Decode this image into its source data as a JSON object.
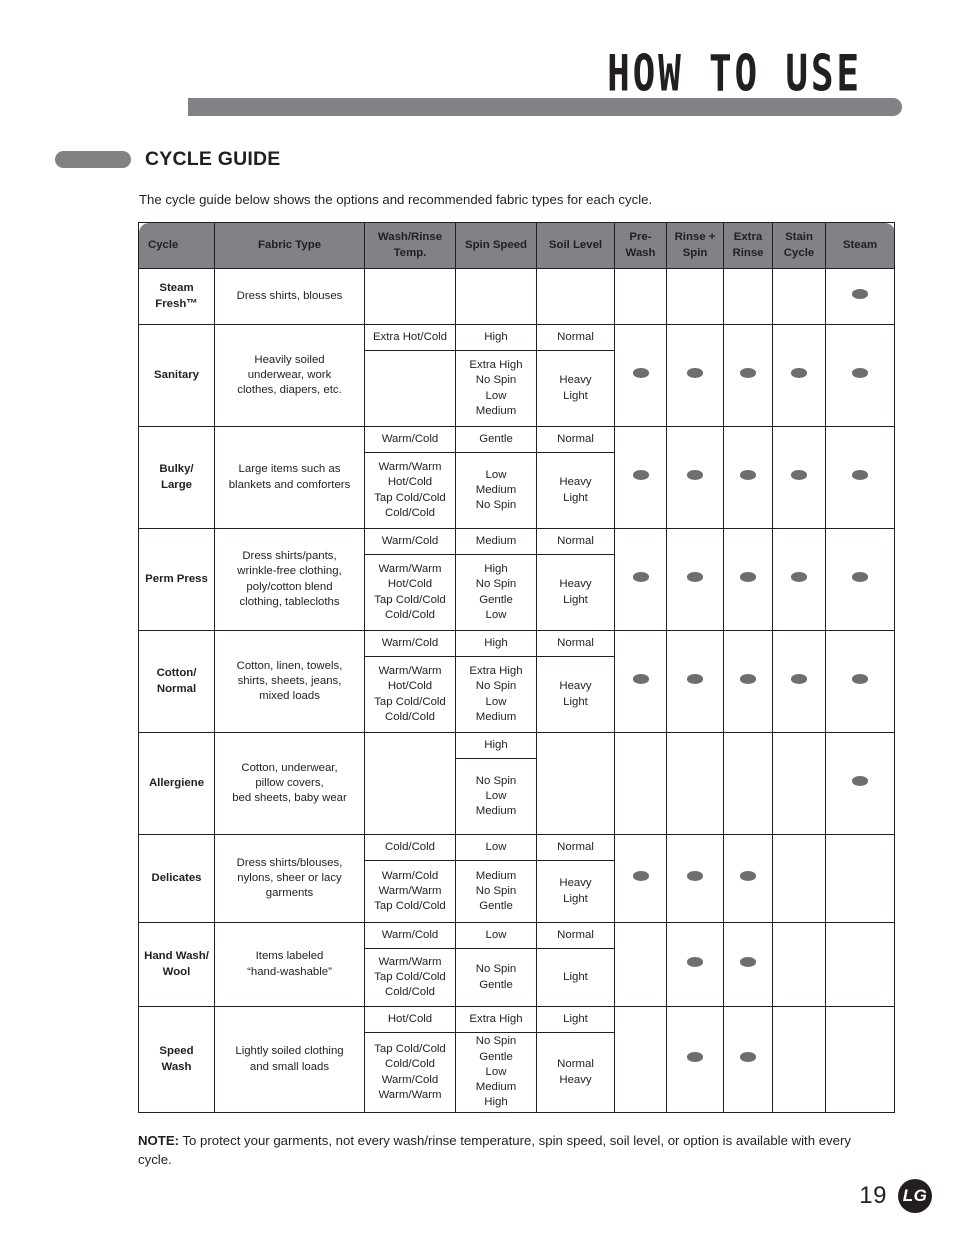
{
  "page": {
    "header_title": "HOW TO USE",
    "section_title": "CYCLE GUIDE",
    "intro": "The cycle guide below shows the options and recommended fabric types for each cycle.",
    "note_label": "NOTE:",
    "note_text": " To protect your garments, not every wash/rinse temperature, spin speed, soil level, or option is available with every cycle.",
    "page_number": "19",
    "brand": "LG",
    "accent_gray": "#808285",
    "dot_color": "#6d6e71",
    "text_color": "#231f20"
  },
  "table": {
    "headers": [
      "Cycle",
      "Fabric Type",
      "Wash/Rinse Temp.",
      "Spin Speed",
      "Soil Level",
      "Pre-Wash",
      "Rinse + Spin",
      "Extra Rinse",
      "Stain Cycle",
      "Steam"
    ],
    "headers_lines": [
      [
        "Cycle"
      ],
      [
        "Fabric Type"
      ],
      [
        "Wash/Rinse",
        "Temp."
      ],
      [
        "Spin Speed"
      ],
      [
        "Soil Level"
      ],
      [
        "Pre-",
        "Wash"
      ],
      [
        "Rinse +",
        "Spin"
      ],
      [
        "Extra",
        "Rinse"
      ],
      [
        "Stain",
        "Cycle"
      ],
      [
        "Steam"
      ]
    ],
    "rows": [
      {
        "cycle": "Steam Fresh™",
        "cycle_lines": [
          "Steam",
          "Fresh™"
        ],
        "fabric": "Dress shirts, blouses",
        "wash_rinse_top": "",
        "wash_rinse_bottom": [],
        "spin_top": "",
        "spin_bottom": [],
        "soil_top": "",
        "soil_bottom": [],
        "options": {
          "pre_wash": false,
          "rinse_spin": false,
          "extra_rinse": false,
          "stain_cycle": false,
          "steam": true
        }
      },
      {
        "cycle": "Sanitary",
        "cycle_lines": [
          "Sanitary"
        ],
        "fabric": "Heavily soiled underwear, work clothes, diapers, etc.",
        "fabric_lines": [
          "Heavily soiled",
          "underwear, work",
          "clothes, diapers, etc."
        ],
        "wash_rinse_top": "Extra Hot/Cold",
        "wash_rinse_bottom": [],
        "spin_top": "High",
        "spin_bottom": [
          "Extra High",
          "No Spin",
          "Low",
          "Medium"
        ],
        "soil_top": "Normal",
        "soil_bottom": [
          "Heavy",
          "Light"
        ],
        "options": {
          "pre_wash": true,
          "rinse_spin": true,
          "extra_rinse": true,
          "stain_cycle": true,
          "steam": true
        }
      },
      {
        "cycle": "Bulky/ Large",
        "cycle_lines": [
          "Bulky/",
          "Large"
        ],
        "fabric": "Large items such as blankets and comforters",
        "fabric_lines": [
          "Large items such as",
          "blankets and comforters"
        ],
        "wash_rinse_top": "Warm/Cold",
        "wash_rinse_bottom": [
          "Warm/Warm",
          "Hot/Cold",
          "Tap Cold/Cold",
          "Cold/Cold"
        ],
        "spin_top": "Gentle",
        "spin_bottom": [
          "Low",
          "Medium",
          "No Spin"
        ],
        "soil_top": "Normal",
        "soil_bottom": [
          "Heavy",
          "Light"
        ],
        "options": {
          "pre_wash": true,
          "rinse_spin": true,
          "extra_rinse": true,
          "stain_cycle": true,
          "steam": true
        }
      },
      {
        "cycle": "Perm Press",
        "cycle_lines": [
          "Perm Press"
        ],
        "fabric": "Dress shirts/pants, wrinkle-free clothing, poly/cotton blend clothing, tablecloths",
        "fabric_lines": [
          "Dress shirts/pants,",
          "wrinkle-free clothing,",
          "poly/cotton blend",
          "clothing, tablecloths"
        ],
        "wash_rinse_top": "Warm/Cold",
        "wash_rinse_bottom": [
          "Warm/Warm",
          "Hot/Cold",
          "Tap Cold/Cold",
          "Cold/Cold"
        ],
        "spin_top": "Medium",
        "spin_bottom": [
          "High",
          "No Spin",
          "Gentle",
          "Low"
        ],
        "soil_top": "Normal",
        "soil_bottom": [
          "Heavy",
          "Light"
        ],
        "options": {
          "pre_wash": true,
          "rinse_spin": true,
          "extra_rinse": true,
          "stain_cycle": true,
          "steam": true
        }
      },
      {
        "cycle": "Cotton/ Normal",
        "cycle_lines": [
          "Cotton/",
          "Normal"
        ],
        "fabric": "Cotton, linen, towels, shirts, sheets, jeans, mixed loads",
        "fabric_lines": [
          "Cotton, linen, towels,",
          "shirts, sheets, jeans,",
          "mixed loads"
        ],
        "wash_rinse_top": "Warm/Cold",
        "wash_rinse_bottom": [
          "Warm/Warm",
          "Hot/Cold",
          "Tap Cold/Cold",
          "Cold/Cold"
        ],
        "spin_top": "High",
        "spin_bottom": [
          "Extra High",
          "No Spin",
          "Low",
          "Medium"
        ],
        "soil_top": "Normal",
        "soil_bottom": [
          "Heavy",
          "Light"
        ],
        "options": {
          "pre_wash": true,
          "rinse_spin": true,
          "extra_rinse": true,
          "stain_cycle": true,
          "steam": true
        }
      },
      {
        "cycle": "Allergiene",
        "cycle_lines": [
          "Allergiene"
        ],
        "fabric": "Cotton, underwear, pillow covers, bed sheets, baby wear",
        "fabric_lines": [
          "Cotton, underwear,",
          "pillow covers,",
          "bed sheets, baby wear"
        ],
        "wash_rinse_top": "",
        "wash_rinse_bottom": [],
        "spin_top": "High",
        "spin_bottom": [
          "No Spin",
          "Low",
          "Medium"
        ],
        "soil_top": "",
        "soil_bottom": [],
        "options": {
          "pre_wash": false,
          "rinse_spin": false,
          "extra_rinse": false,
          "stain_cycle": false,
          "steam": true
        }
      },
      {
        "cycle": "Delicates",
        "cycle_lines": [
          "Delicates"
        ],
        "fabric": "Dress shirts/blouses, nylons, sheer or lacy garments",
        "fabric_lines": [
          "Dress shirts/blouses,",
          "nylons, sheer or lacy",
          "garments"
        ],
        "wash_rinse_top": "Cold/Cold",
        "wash_rinse_bottom": [
          "Warm/Cold",
          "Warm/Warm",
          "Tap Cold/Cold"
        ],
        "spin_top": "Low",
        "spin_bottom": [
          "Medium",
          "No Spin",
          "Gentle"
        ],
        "soil_top": "Normal",
        "soil_bottom": [
          "Heavy",
          "Light"
        ],
        "options": {
          "pre_wash": true,
          "rinse_spin": true,
          "extra_rinse": true,
          "stain_cycle": false,
          "steam": false
        }
      },
      {
        "cycle": "Hand Wash/ Wool",
        "cycle_lines": [
          "Hand Wash/",
          "Wool"
        ],
        "fabric": "Items labeled “hand-washable”",
        "fabric_lines": [
          "Items labeled",
          "“hand-washable”"
        ],
        "wash_rinse_top": "Warm/Cold",
        "wash_rinse_bottom": [
          "Warm/Warm",
          "Tap Cold/Cold",
          "Cold/Cold"
        ],
        "spin_top": "Low",
        "spin_bottom": [
          "No Spin",
          "Gentle"
        ],
        "soil_top": "Normal",
        "soil_bottom": [
          "Light"
        ],
        "options": {
          "pre_wash": false,
          "rinse_spin": true,
          "extra_rinse": true,
          "stain_cycle": false,
          "steam": false
        }
      },
      {
        "cycle": "Speed Wash",
        "cycle_lines": [
          "Speed",
          "Wash"
        ],
        "fabric": "Lightly soiled clothing and small loads",
        "fabric_lines": [
          "Lightly soiled clothing",
          "and small loads"
        ],
        "wash_rinse_top": "Hot/Cold",
        "wash_rinse_bottom": [
          "Tap Cold/Cold",
          "Cold/Cold",
          "Warm/Cold",
          "Warm/Warm"
        ],
        "spin_top": "Extra High",
        "spin_bottom": [
          "No Spin",
          "Gentle",
          "Low",
          "Medium",
          "High"
        ],
        "soil_top": "Light",
        "soil_bottom": [
          "Normal",
          "Heavy"
        ],
        "options": {
          "pre_wash": false,
          "rinse_spin": true,
          "extra_rinse": true,
          "stain_cycle": false,
          "steam": false
        }
      }
    ]
  }
}
